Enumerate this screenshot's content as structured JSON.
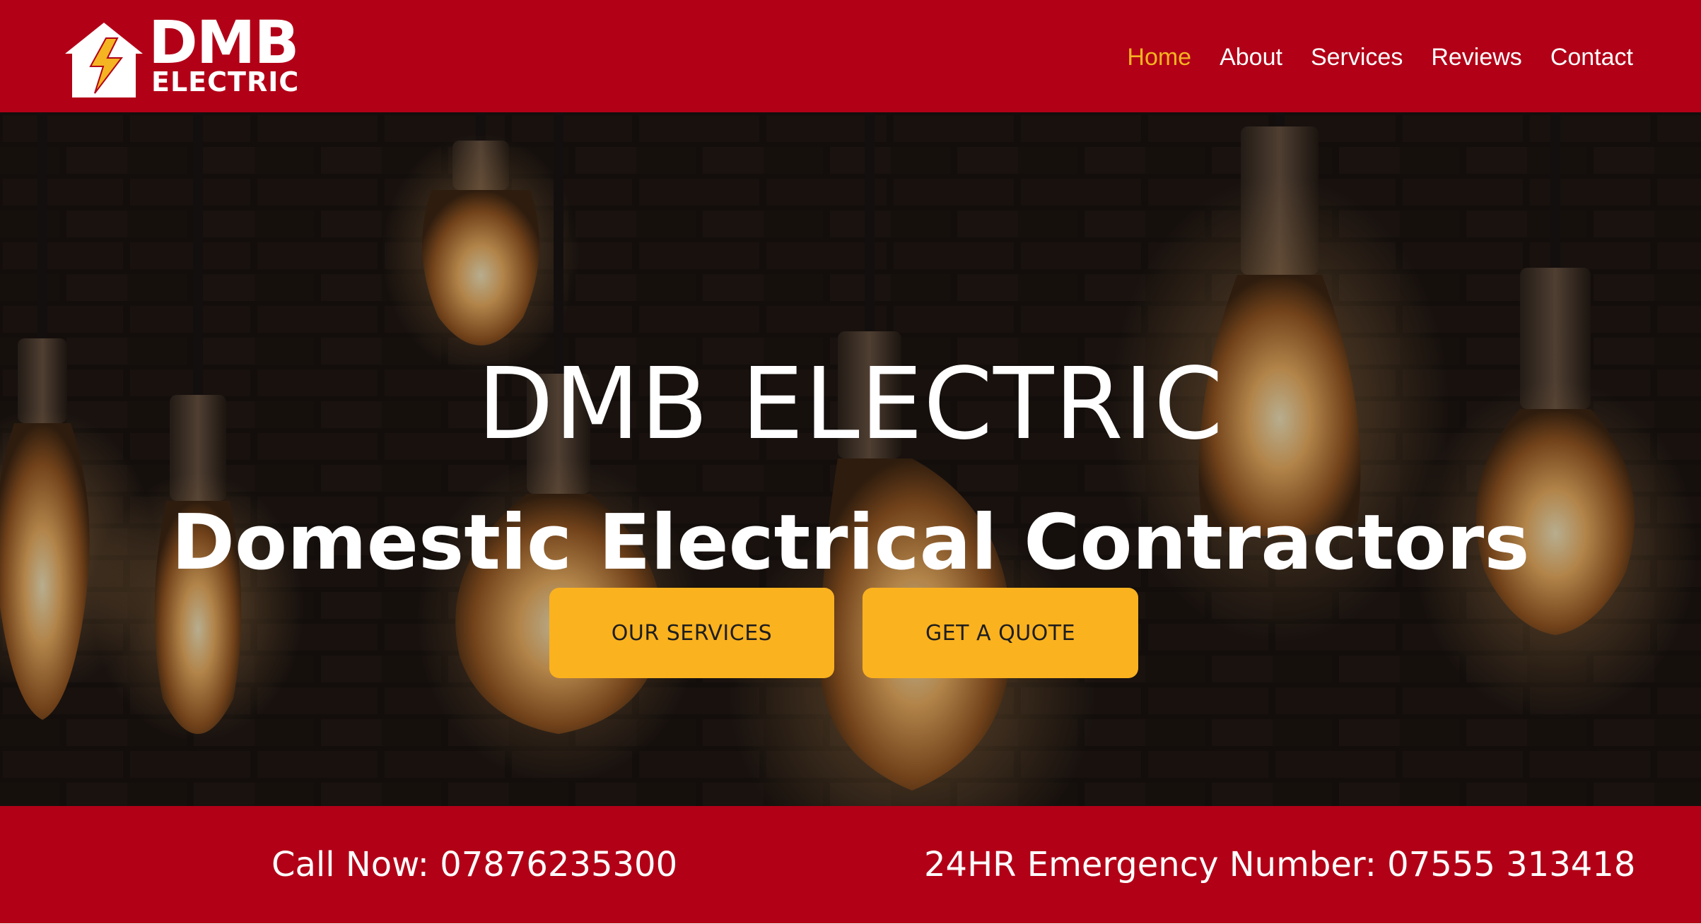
{
  "logo": {
    "line1": "DMB",
    "line2": "ELECTRIC"
  },
  "nav": {
    "items": [
      {
        "label": "Home",
        "active": true
      },
      {
        "label": "About",
        "active": false
      },
      {
        "label": "Services",
        "active": false
      },
      {
        "label": "Reviews",
        "active": false
      },
      {
        "label": "Contact",
        "active": false
      }
    ]
  },
  "hero": {
    "title": "DMB ELECTRIC",
    "subtitle": "Domestic Electrical Contractors",
    "buttons": {
      "services": "OUR SERVICES",
      "quote": "GET A QUOTE"
    }
  },
  "contact_bar": {
    "call_now": "Call Now: 07876235300",
    "emergency": "24HR Emergency Number: 07555 313418"
  },
  "colors": {
    "brand_red": "#b20017",
    "accent_yellow": "#fbb21f",
    "nav_active": "#f5b421"
  }
}
